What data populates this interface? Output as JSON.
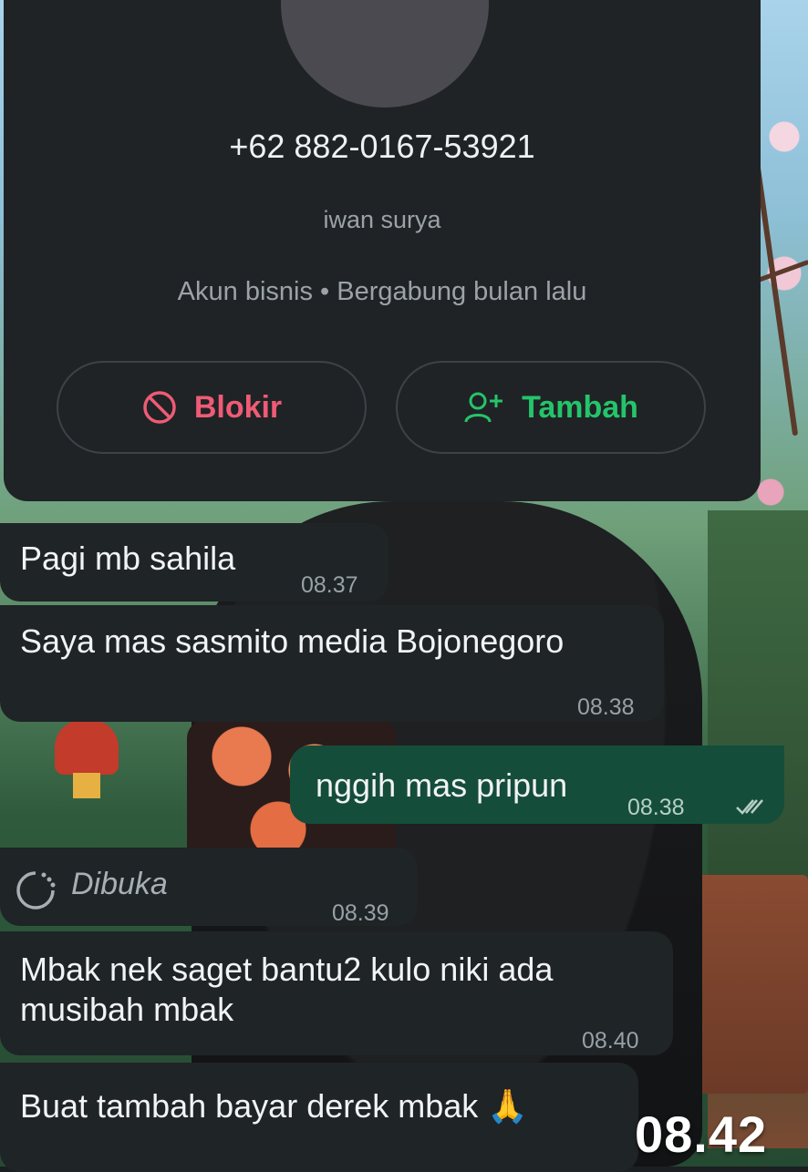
{
  "contact": {
    "phone": "+62 882-0167-53921",
    "name": "iwan surya",
    "meta": "Akun bisnis • Bergabung bulan lalu"
  },
  "actions": {
    "block_label": "Blokir",
    "add_label": "Tambah",
    "block_icon": "block-icon",
    "add_icon": "add-person-icon"
  },
  "messages": [
    {
      "direction": "in",
      "text": "Pagi mb sahila",
      "time": "08.37"
    },
    {
      "direction": "in",
      "text": "Saya mas sasmito media Bojonegoro",
      "time": "08.38"
    },
    {
      "direction": "out",
      "text": "nggih mas pripun",
      "time": "08.38",
      "status": "read-ticks"
    },
    {
      "direction": "in",
      "text": "Dibuka",
      "time": "08.39",
      "type": "view-once-opened"
    },
    {
      "direction": "in",
      "text": "Mbak nek saget bantu2 kulo niki ada\nmusibah mbak",
      "time": "08.40"
    },
    {
      "direction": "in",
      "text": "Buat tambah bayar derek mbak 🙏",
      "time": ""
    }
  ],
  "overlay_clock": "08.42",
  "colors": {
    "card_bg": "#1f2326",
    "bubble_in": "#1f2427",
    "bubble_out": "#154d3b",
    "block_red": "#ef5b75",
    "add_green": "#25c46a"
  }
}
